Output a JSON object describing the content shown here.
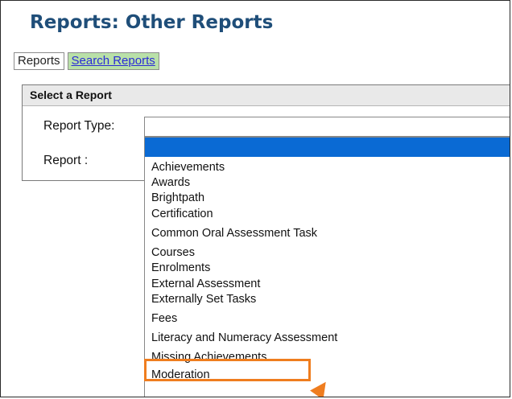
{
  "page": {
    "title": "Reports: Other Reports"
  },
  "tabs": [
    {
      "label": "Reports"
    },
    {
      "label": "Search Reports"
    }
  ],
  "panel": {
    "header": "Select a Report",
    "report_type_label": "Report Type:",
    "report_label": "Report :"
  },
  "dropdown": {
    "selected_value": "",
    "options": [
      "Achievements",
      "Awards",
      "Brightpath",
      "Certification",
      "Common Oral Assessment Task",
      "Courses",
      "Enrolments",
      "External Assessment",
      "Externally Set Tasks",
      "Fees",
      "Literacy and Numeracy Assessment",
      "Missing Achievements",
      "Moderation"
    ],
    "highlighted_option": "Missing Achievements"
  },
  "colors": {
    "title": "#1f4e79",
    "selection": "#0a6ad4",
    "highlight": "#ef7d1f",
    "tab_green": "#b9e0a8"
  }
}
